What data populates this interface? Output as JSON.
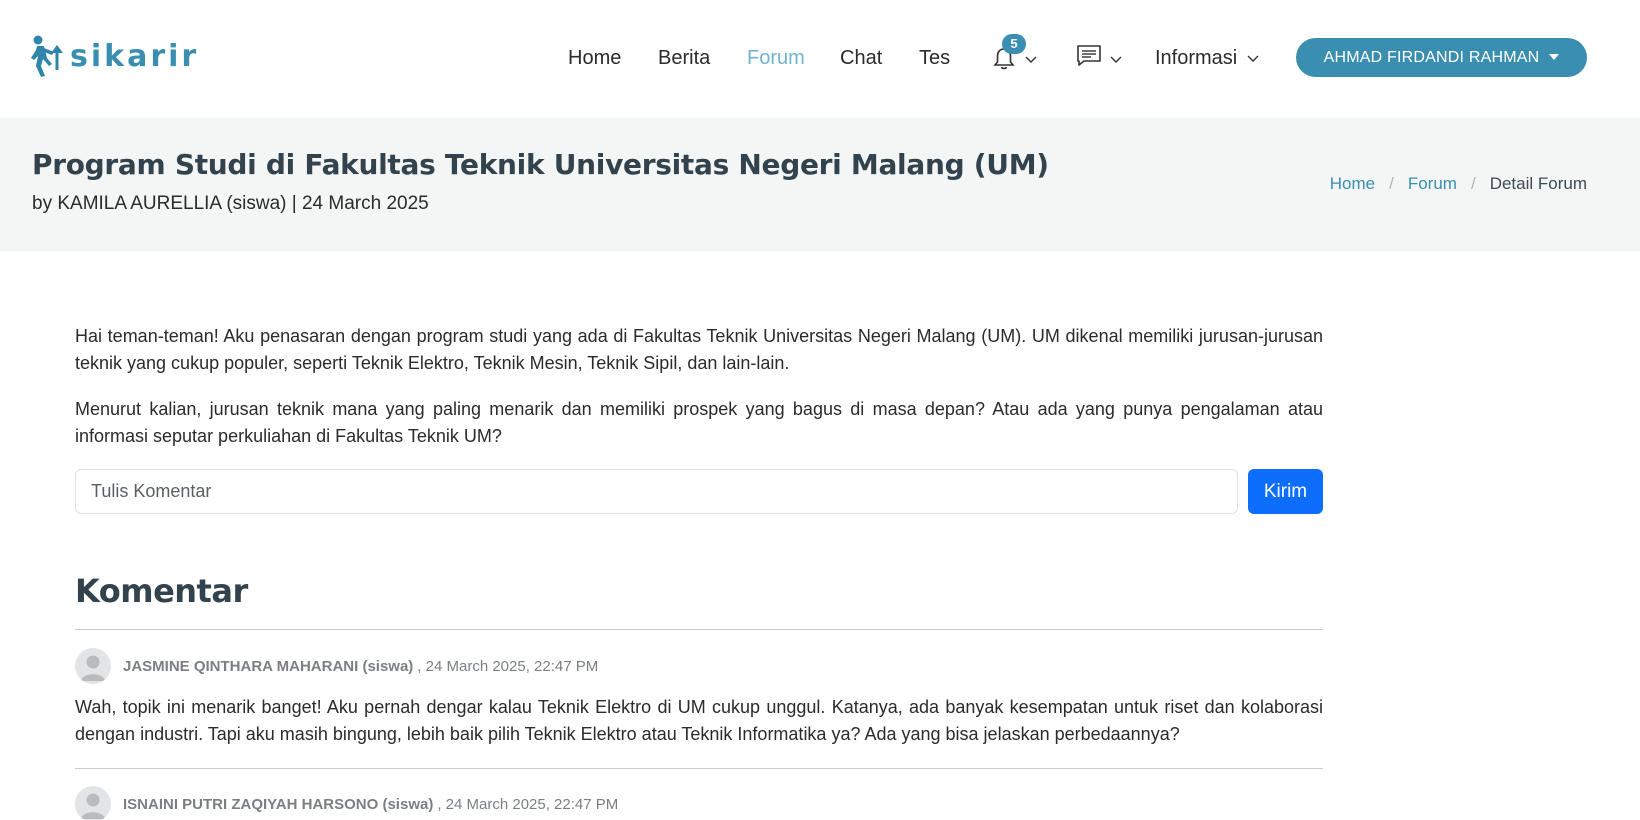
{
  "brand": {
    "name": "sikarir",
    "color": "#3a8fb0"
  },
  "nav": {
    "home": "Home",
    "berita": "Berita",
    "forum": "Forum",
    "chat": "Chat",
    "tes": "Tes",
    "notification_count": "5",
    "informasi": "Informasi",
    "user_name": "AHMAD FIRDANDI RAHMAN",
    "active": "Forum"
  },
  "title_bar": {
    "title": "Program Studi di Fakultas Teknik Universitas Negeri Malang (UM)",
    "byline": "by KAMILA AURELLIA (siswa) | 24 March 2025",
    "breadcrumb": [
      "Home",
      "Forum",
      "Detail Forum"
    ]
  },
  "post": {
    "paragraphs": [
      "Hai teman-teman! Aku penasaran dengan program studi yang ada di Fakultas Teknik Universitas Negeri Malang (UM). UM dikenal memiliki jurusan-jurusan teknik yang cukup populer, seperti Teknik Elektro, Teknik Mesin, Teknik Sipil, dan lain-lain.",
      "Menurut kalian, jurusan teknik mana yang paling menarik dan memiliki prospek yang bagus di masa depan? Atau ada yang punya pengalaman atau informasi seputar perkuliahan di Fakultas Teknik UM?"
    ]
  },
  "comment_form": {
    "placeholder": "Tulis Komentar",
    "submit_label": "Kirim"
  },
  "comments_section": {
    "heading": "Komentar",
    "items": [
      {
        "author": "JASMINE QINTHARA MAHARANI (siswa)",
        "date": ", 24 March 2025, 22:47 PM",
        "body": "Wah, topik ini menarik banget! Aku pernah dengar kalau Teknik Elektro di UM cukup unggul. Katanya, ada banyak kesempatan untuk riset dan kolaborasi dengan industri. Tapi aku masih bingung, lebih baik pilih Teknik Elektro atau Teknik Informatika ya? Ada yang bisa jelaskan perbedaannya?"
      },
      {
        "author": "ISNAINI PUTRI ZAQIYAH HARSONO (siswa)",
        "date": ", 24 March 2025, 22:47 PM",
        "body": ""
      }
    ]
  },
  "colors": {
    "accent": "#3a8fb0",
    "nav_active": "#6fb4d1",
    "primary_button": "#0d6efd",
    "title_bar_bg": "#f4f6f6"
  },
  "icons": [
    "runner-logo-icon",
    "bell-icon",
    "message-icon",
    "chevron-down-icon",
    "avatar-placeholder-icon"
  ]
}
